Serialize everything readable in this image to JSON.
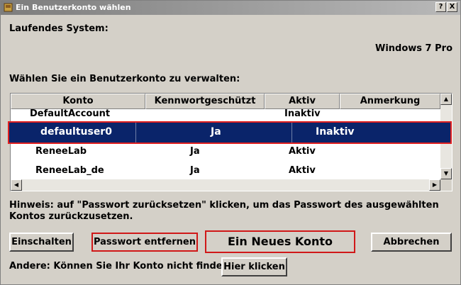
{
  "window": {
    "title": "Ein Benutzerkonto wählen",
    "help_label": "?",
    "close_label": "X"
  },
  "system": {
    "label": "Laufendes System:",
    "value": "Windows  7  Pro"
  },
  "accounts_label": "Wählen Sie ein Benutzerkonto zu verwalten:",
  "table": {
    "columns": [
      "Konto",
      "Kennwortgeschützt",
      "Aktiv",
      "Anmerkung"
    ],
    "rows": [
      {
        "konto": "DefaultAccount",
        "kennwort": "",
        "aktiv": "Inaktiv",
        "anmerkung": ""
      },
      {
        "konto": "defaultuser0",
        "kennwort": "Ja",
        "aktiv": "Inaktiv",
        "anmerkung": ""
      },
      {
        "konto": "ReneeLab",
        "kennwort": "Ja",
        "aktiv": "Aktiv",
        "anmerkung": ""
      },
      {
        "konto": "ReneeLab_de",
        "kennwort": "Ja",
        "aktiv": "Aktiv",
        "anmerkung": ""
      }
    ]
  },
  "hint": "Hinweis: auf \"Passwort zurücksetzen\" klicken, um das Passwort des ausgewählten Kontos zurückzusetzen.",
  "buttons": {
    "enable": "Einschalten",
    "remove_password": "Passwort entfernen",
    "new_account": "Ein Neues Konto",
    "cancel": "Abbrechen",
    "click_here": "Hier klicken"
  },
  "other_label": "Andere: Können Sie Ihr Konto nicht finden?",
  "colors": {
    "selection": "#0a246a",
    "highlight_border": "#e02020",
    "face": "#d4d0c8"
  }
}
